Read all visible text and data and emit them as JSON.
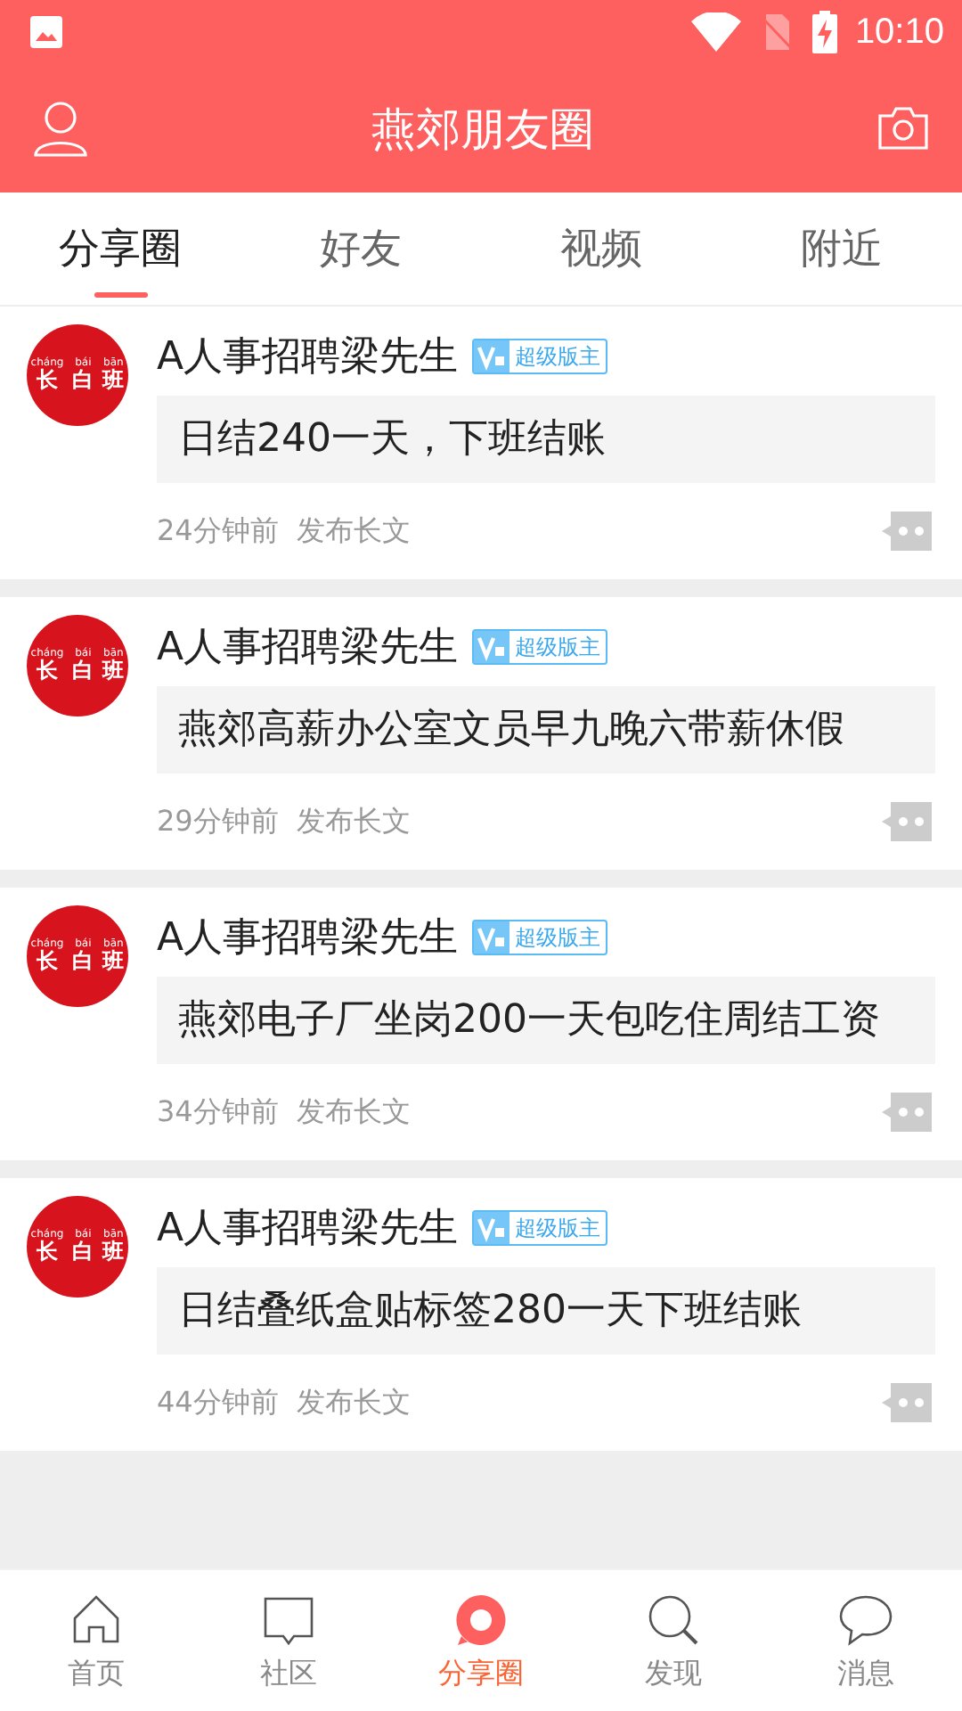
{
  "status_bar": {
    "time": "10:10"
  },
  "header": {
    "title": "燕郊朋友圈"
  },
  "tabs": [
    {
      "label": "分享圈",
      "selected": true
    },
    {
      "label": "好友",
      "selected": false
    },
    {
      "label": "视频",
      "selected": false
    },
    {
      "label": "附近",
      "selected": false
    }
  ],
  "posts": [
    {
      "avatar": {
        "pinyin": [
          "cháng",
          "bái",
          "bān"
        ],
        "chars": [
          "长",
          "白",
          "班"
        ]
      },
      "author": "A人事招聘梁先生",
      "badge": "超级版主",
      "content": "日结240一天，下班结账",
      "time": "24分钟前",
      "action": "发布长文"
    },
    {
      "avatar": {
        "pinyin": [
          "cháng",
          "bái",
          "bān"
        ],
        "chars": [
          "长",
          "白",
          "班"
        ]
      },
      "author": "A人事招聘梁先生",
      "badge": "超级版主",
      "content": "燕郊高薪办公室文员早九晚六带薪休假",
      "time": "29分钟前",
      "action": "发布长文"
    },
    {
      "avatar": {
        "pinyin": [
          "cháng",
          "bái",
          "bān"
        ],
        "chars": [
          "长",
          "白",
          "班"
        ]
      },
      "author": "A人事招聘梁先生",
      "badge": "超级版主",
      "content": "燕郊电子厂坐岗200一天包吃住周结工资",
      "time": "34分钟前",
      "action": "发布长文"
    },
    {
      "avatar": {
        "pinyin": [
          "cháng",
          "bái",
          "bān"
        ],
        "chars": [
          "长",
          "白",
          "班"
        ]
      },
      "author": "A人事招聘梁先生",
      "badge": "超级版主",
      "content": "日结叠纸盒贴标签280一天下班结账",
      "time": "44分钟前",
      "action": "发布长文"
    }
  ],
  "bottom_nav": [
    {
      "kind": "home",
      "label": "首页",
      "selected": false
    },
    {
      "kind": "community",
      "label": "社区",
      "selected": false
    },
    {
      "kind": "share",
      "label": "分享圈",
      "selected": true
    },
    {
      "kind": "discover",
      "label": "发现",
      "selected": false
    },
    {
      "kind": "messages",
      "label": "消息",
      "selected": false
    }
  ]
}
